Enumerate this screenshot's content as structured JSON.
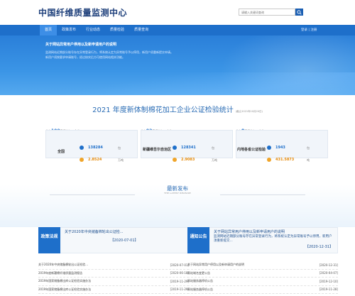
{
  "header": {
    "site_title": "中国纤维质量监测中心",
    "search_placeholder": "请输入关键词查询",
    "top_links": "登录 | 注册"
  },
  "nav": {
    "items": [
      {
        "label": "首页"
      },
      {
        "label": "政策发布"
      },
      {
        "label": "行业动态"
      },
      {
        "label": "质量检验"
      },
      {
        "label": "质量查询"
      }
    ]
  },
  "banner": {
    "title": "关于网站异常用户停用以及新申请用户的说明",
    "lines": [
      "监测网站近期部分账号存在异常登录行为，将系统认定为异常账号予以停用，新用户须重新提交申请。",
      "新用户须按要求申请账号，经过核实后方可使用网站相关功能。"
    ]
  },
  "stats": {
    "title": "2021 年度新体制棉花加工企业公证检验统计",
    "subtitle": "(截止2021年10月20日)",
    "cards": [
      {
        "count_prefix": "共有",
        "count": "100",
        "count_suffix": "家棉花加工企业",
        "label": "全国",
        "row1_value": "138284",
        "row1_unit": "包",
        "row2_value": "2.8524",
        "row2_unit": "万吨"
      },
      {
        "count_prefix": "共有",
        "count": "92",
        "count_suffix": "家棉花加工企业",
        "label": "新疆维吾尔自治区",
        "row1_value": "128341",
        "row1_unit": "包",
        "row2_value": "2.9083",
        "row2_unit": "万吨"
      },
      {
        "count_prefix": "共有",
        "count": "8",
        "count_suffix": "家棉花加工企业",
        "label": "内地各省公证检验",
        "row1_value": "1943",
        "row1_unit": "包",
        "row2_value": "431.5873",
        "row2_unit": "吨"
      }
    ]
  },
  "latest": {
    "title": "最新发布",
    "subtitle": "THE LATEST RELEASE"
  },
  "policy": {
    "tag": "政策法规",
    "feature_title": "关于2020年中央储备棉轮出公证检...",
    "feature_date": "【2020-07-01】",
    "list": [
      {
        "title": "关于2020年中央储备棉轮出公证检验...",
        "date": "[2020-07-01]"
      },
      {
        "title": "2019年度新疆棉纤维质量监测报告",
        "date": "[2020-06-18]"
      },
      {
        "title": "2019年国家储备棉出库公证检验实施办法",
        "date": "[2019-11-29]"
      },
      {
        "title": "2019年国家储备棉出库公证检验实施办法",
        "date": "[2019-11-29]"
      }
    ]
  },
  "notice": {
    "tag": "通知公告",
    "feature_title": "关于网站异常用户停用以及新申请用户的说明",
    "feature_text": "监测网站近期部分账号存在异常登录行为，将系统认定为异常账号予以停用，新用户须重新提交...",
    "feature_date": "【2020-12-31】",
    "list": [
      {
        "title": "关于网站异常用户停用以及新申请用户的说明",
        "date": "[2020-12-31]"
      },
      {
        "title": "网站域名变更公告",
        "date": "[2020-04-07]"
      },
      {
        "title": "网站服务器停机公告",
        "date": "[2019-12-10]"
      },
      {
        "title": "网站服务器停机公告",
        "date": "[2019-11-28]"
      }
    ]
  },
  "colors": {
    "brand_blue": "#1e6fca",
    "accent_orange": "#f0a52a",
    "title_navy": "#1c3e7a"
  }
}
